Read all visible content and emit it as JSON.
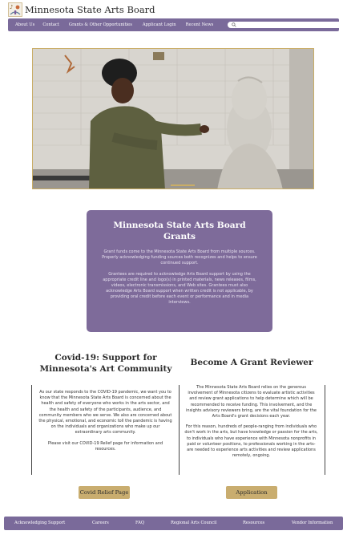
{
  "site": {
    "title": "Minnesota State Arts Board",
    "logo_icon": "msab-logo-icon"
  },
  "nav": {
    "items": [
      {
        "label": "About Us"
      },
      {
        "label": "Contact"
      },
      {
        "label": "Grants & Other Opportunities"
      },
      {
        "label": "Applicant Login"
      },
      {
        "label": "Recent News"
      }
    ],
    "search": {
      "placeholder": "",
      "icon": "search-icon"
    }
  },
  "hero": {
    "image_alt": "Sculptor working on a large clay bust in a studio"
  },
  "grants": {
    "title_line1": "Minnesota State Arts Board",
    "title_line2": "Grants",
    "p1": "Grant funds come to the Minnesota State Arts Board from multiple sources. Properly acknowledging funding sources both recognizes and helps to ensure continued support.",
    "p2": "Grantees are required to acknowledge Arts Board support by using the appropriate credit line and logo(s) in printed materials, news releases, films, videos, electronic transmissions, and Web sites. Grantees must also acknowledge Arts Board support when written credit is not applicable, by providing oral credit before each event or performance and in media interviews."
  },
  "covid": {
    "title_line1": "Covid-19: Support for",
    "title_line2": "Minnesota's Art Community",
    "p1": "As our state responds to the COVID-19 pandemic, we want you to know that the Minnesota State Arts Board is concerned about the health and safety of everyone who works in the arts sector, and the health and safety of the participants, audience, and community members who we serve. We also are concerned about the physical, emotional, and economic toll the pandemic is having on the individuals and organizations who make up our extraordinary arts community.",
    "p2": "Please visit our COVID-19 Relief page for information and resources.",
    "button": "Covid Relief Page"
  },
  "reviewer": {
    "title": "Become A Grant Reviewer",
    "p1": "The Minnesota State Arts Board relies on the generous involvement of Minnesota citizens to evaluate artistic activities and review grant applications to help determine which will be recommended to receive funding. This involvement, and the insights advisory reviewers bring, are the vital foundation for the Arts Board's grant decisions each year.",
    "p2": "For this reason, hundreds of people-ranging from individuals who don't work in the arts, but have knowledge or passion for the arts, to individuals who have experience with Minnesota nonprofits in paid or volunteer positions, to professionals working in the arts-are needed to experience arts activities and review applications remotely, ongoing.",
    "button": "Application"
  },
  "footer": {
    "items": [
      {
        "label": "Acknowledging  Support"
      },
      {
        "label": "Careers"
      },
      {
        "label": "FAQ"
      },
      {
        "label": "Regional Arts Council"
      },
      {
        "label": "Resources"
      },
      {
        "label": "Vendor Information"
      }
    ]
  },
  "colors": {
    "nav_bg": "#7a6a9a",
    "card_bg": "#7e6b9a",
    "accent_gold": "#c9ad66"
  }
}
